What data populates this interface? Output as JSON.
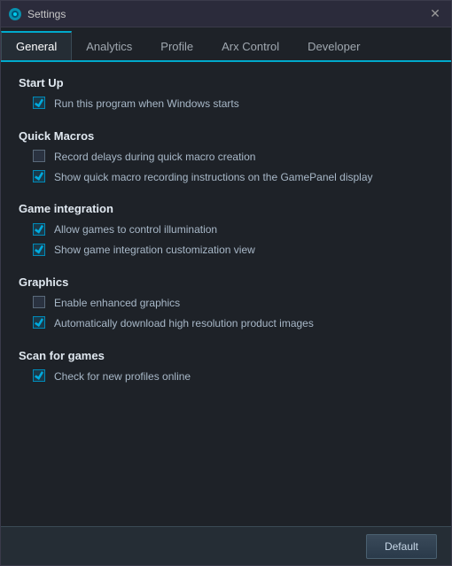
{
  "window": {
    "title": "Settings",
    "icon": "⚙"
  },
  "tabs": [
    {
      "id": "general",
      "label": "General",
      "active": true
    },
    {
      "id": "analytics",
      "label": "Analytics",
      "active": false
    },
    {
      "id": "profile",
      "label": "Profile",
      "active": false
    },
    {
      "id": "arx-control",
      "label": "Arx Control",
      "active": false
    },
    {
      "id": "developer",
      "label": "Developer",
      "active": false
    }
  ],
  "sections": [
    {
      "id": "startup",
      "title": "Start Up",
      "items": [
        {
          "id": "startup-run",
          "label": "Run this program when Windows starts",
          "checked": true
        }
      ]
    },
    {
      "id": "quick-macros",
      "title": "Quick Macros",
      "items": [
        {
          "id": "macros-record",
          "label": "Record delays during quick macro creation",
          "checked": false
        },
        {
          "id": "macros-show",
          "label": "Show quick macro recording instructions on the GamePanel display",
          "checked": true
        }
      ]
    },
    {
      "id": "game-integration",
      "title": "Game integration",
      "items": [
        {
          "id": "game-allow",
          "label": "Allow games to control illumination",
          "checked": true
        },
        {
          "id": "game-show",
          "label": "Show game integration customization view",
          "checked": true
        }
      ]
    },
    {
      "id": "graphics",
      "title": "Graphics",
      "items": [
        {
          "id": "graphics-enhanced",
          "label": "Enable enhanced graphics",
          "checked": false
        },
        {
          "id": "graphics-download",
          "label": "Automatically download high resolution product images",
          "checked": true
        }
      ]
    },
    {
      "id": "scan-games",
      "title": "Scan for games",
      "items": [
        {
          "id": "scan-check",
          "label": "Check for new profiles online",
          "checked": true
        }
      ]
    }
  ],
  "buttons": {
    "default_label": "Default"
  }
}
